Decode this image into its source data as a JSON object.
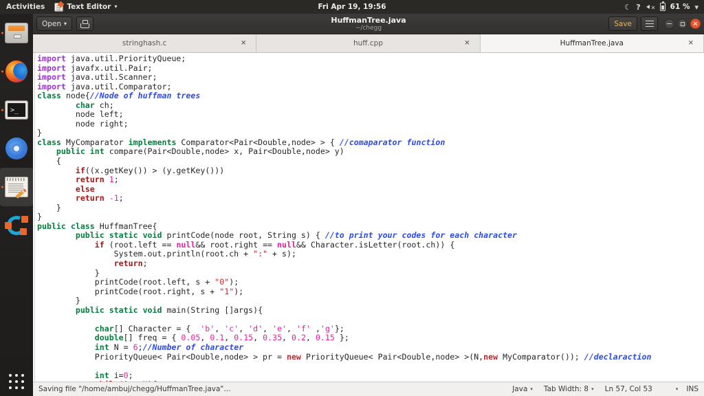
{
  "topbar": {
    "activities": "Activities",
    "app_menu": "Text Editor",
    "app_menu_caret": "▾",
    "clock": "Fri Apr 19, 19:56",
    "night_light_icon": "moon-icon",
    "help_icon": "?",
    "volume_icon": "volume-muted-icon",
    "battery_icon": "battery-icon",
    "battery_percent": "61 %",
    "system_menu_caret": "▾"
  },
  "dock": {
    "items": [
      {
        "name": "files",
        "icon": "file-manager-icon",
        "running": true,
        "active": false
      },
      {
        "name": "firefox",
        "icon": "firefox-icon",
        "running": true,
        "active": false
      },
      {
        "name": "terminal",
        "icon": "terminal-icon",
        "running": true,
        "active": false
      },
      {
        "name": "chromium",
        "icon": "chromium-icon",
        "running": false,
        "active": false
      },
      {
        "name": "text-editor",
        "icon": "text-editor-icon",
        "running": true,
        "active": true
      },
      {
        "name": "ubuntu-software",
        "icon": "ubuntu-software-icon",
        "running": false,
        "active": false
      }
    ],
    "show_apps": "show-applications-icon"
  },
  "window": {
    "open_button": "Open",
    "open_caret": "▾",
    "saveas_icon": "save-as-icon",
    "title": "HuffmanTree.java",
    "subtitle": "~/chegg",
    "save_button": "Save",
    "menu_icon": "hamburger-menu-icon",
    "minimize_icon": "minimize-icon",
    "maximize_icon": "maximize-icon",
    "close_icon": "close-icon"
  },
  "tabs": [
    {
      "label": "stringhash.c",
      "close": "✕",
      "active": false
    },
    {
      "label": "huff.cpp",
      "close": "✕",
      "active": false
    },
    {
      "label": "HuffmanTree.java",
      "close": "✕",
      "active": true
    }
  ],
  "editor": {
    "language": "Java",
    "lines": [
      [
        [
          "kp",
          "import"
        ],
        [
          "txt",
          " java.util.PriorityQueue;"
        ]
      ],
      [
        [
          "kp",
          "import"
        ],
        [
          "txt",
          " javafx.util.Pair;"
        ]
      ],
      [
        [
          "kp",
          "import"
        ],
        [
          "txt",
          " java.util.Scanner;"
        ]
      ],
      [
        [
          "kp",
          "import"
        ],
        [
          "txt",
          " java.util.Comparator;"
        ]
      ],
      [
        [
          "k",
          "class"
        ],
        [
          "txt",
          " node{"
        ],
        [
          "cmt",
          "//Node of huffman trees"
        ]
      ],
      [
        [
          "txt",
          "        "
        ],
        [
          "k",
          "char"
        ],
        [
          "txt",
          " ch;"
        ]
      ],
      [
        [
          "txt",
          "        node left;"
        ]
      ],
      [
        [
          "txt",
          "        node right;"
        ]
      ],
      [
        [
          "txt",
          "}"
        ]
      ],
      [
        [
          "k",
          "class"
        ],
        [
          "txt",
          " MyComparator "
        ],
        [
          "k",
          "implements"
        ],
        [
          "txt",
          " Comparator<Pair<Double,node> > { "
        ],
        [
          "cmt",
          "//comaparator function"
        ]
      ],
      [
        [
          "txt",
          "    "
        ],
        [
          "k",
          "public int"
        ],
        [
          "txt",
          " compare(Pair<Double,node> x, Pair<Double,node> y)"
        ]
      ],
      [
        [
          "txt",
          "    {"
        ]
      ],
      [
        [
          "txt",
          "        "
        ],
        [
          "ctl",
          "if"
        ],
        [
          "txt",
          "((x.getKey()) > (y.getKey()))"
        ]
      ],
      [
        [
          "txt",
          "        "
        ],
        [
          "ctl",
          "return"
        ],
        [
          "txt",
          " "
        ],
        [
          "num",
          "1"
        ],
        [
          "txt",
          ";"
        ]
      ],
      [
        [
          "txt",
          "        "
        ],
        [
          "ctl",
          "else"
        ]
      ],
      [
        [
          "txt",
          "        "
        ],
        [
          "ctl",
          "return"
        ],
        [
          "txt",
          " "
        ],
        [
          "num",
          "-1"
        ],
        [
          "txt",
          ";"
        ]
      ],
      [
        [
          "txt",
          "    }"
        ]
      ],
      [
        [
          "txt",
          "}"
        ]
      ],
      [
        [
          "k",
          "public class"
        ],
        [
          "txt",
          " HuffmanTree{"
        ]
      ],
      [
        [
          "txt",
          "        "
        ],
        [
          "k",
          "public static void"
        ],
        [
          "txt",
          " printCode(node root, String s) { "
        ],
        [
          "cmt",
          "//to print your codes for each character"
        ]
      ],
      [
        [
          "txt",
          "            "
        ],
        [
          "ctl",
          "if"
        ],
        [
          "txt",
          " (root.left == "
        ],
        [
          "nul",
          "null"
        ],
        [
          "txt",
          "&& root.right == "
        ],
        [
          "nul",
          "null"
        ],
        [
          "txt",
          "&& Character.isLetter(root.ch)) {"
        ]
      ],
      [
        [
          "txt",
          "                System.out.println(root.ch + "
        ],
        [
          "str",
          "\":\""
        ],
        [
          "txt",
          " + s);"
        ]
      ],
      [
        [
          "txt",
          "                "
        ],
        [
          "ctl",
          "return"
        ],
        [
          "txt",
          ";"
        ]
      ],
      [
        [
          "txt",
          "            }"
        ]
      ],
      [
        [
          "txt",
          "            printCode(root.left, s + "
        ],
        [
          "str",
          "\"0\""
        ],
        [
          "txt",
          ");"
        ]
      ],
      [
        [
          "txt",
          "            printCode(root.right, s + "
        ],
        [
          "str",
          "\"1\""
        ],
        [
          "txt",
          ");"
        ]
      ],
      [
        [
          "txt",
          "        }"
        ]
      ],
      [
        [
          "txt",
          "        "
        ],
        [
          "k",
          "public static void"
        ],
        [
          "txt",
          " main(String []args){"
        ]
      ],
      [
        [
          "txt",
          ""
        ]
      ],
      [
        [
          "txt",
          "            "
        ],
        [
          "k",
          "char"
        ],
        [
          "txt",
          "[] Character = {  "
        ],
        [
          "num",
          "'b'"
        ],
        [
          "txt",
          ", "
        ],
        [
          "num",
          "'c'"
        ],
        [
          "txt",
          ", "
        ],
        [
          "num",
          "'d'"
        ],
        [
          "txt",
          ", "
        ],
        [
          "num",
          "'e'"
        ],
        [
          "txt",
          ", "
        ],
        [
          "num",
          "'f'"
        ],
        [
          "txt",
          " ,"
        ],
        [
          "num",
          "'g'"
        ],
        [
          "txt",
          "};"
        ]
      ],
      [
        [
          "txt",
          "            "
        ],
        [
          "k",
          "double"
        ],
        [
          "txt",
          "[] freq = { "
        ],
        [
          "num",
          "0.05"
        ],
        [
          "txt",
          ", "
        ],
        [
          "num",
          "0.1"
        ],
        [
          "txt",
          ", "
        ],
        [
          "num",
          "0.15"
        ],
        [
          "txt",
          ", "
        ],
        [
          "num",
          "0.35"
        ],
        [
          "txt",
          ", "
        ],
        [
          "num",
          "0.2"
        ],
        [
          "txt",
          ", "
        ],
        [
          "num",
          "0.15"
        ],
        [
          "txt",
          " };"
        ]
      ],
      [
        [
          "txt",
          "            "
        ],
        [
          "k",
          "int"
        ],
        [
          "txt",
          " N = "
        ],
        [
          "num",
          "6"
        ],
        [
          "txt",
          ";"
        ],
        [
          "cmt",
          "//Number of character"
        ]
      ],
      [
        [
          "txt",
          "            PriorityQueue< Pair<Double,node> > pr = "
        ],
        [
          "nw",
          "new"
        ],
        [
          "txt",
          " PriorityQueue< Pair<Double,node> >(N,"
        ],
        [
          "nw",
          "new"
        ],
        [
          "txt",
          " MyComparator()); "
        ],
        [
          "cmt",
          "//declaraction"
        ]
      ],
      [
        [
          "txt",
          ""
        ]
      ],
      [
        [
          "txt",
          "            "
        ],
        [
          "k",
          "int"
        ],
        [
          "txt",
          " i="
        ],
        [
          "num",
          "0"
        ],
        [
          "txt",
          ";"
        ]
      ],
      [
        [
          "txt",
          "            "
        ],
        [
          "ctl",
          "while"
        ],
        [
          "txt",
          "(i < N){"
        ]
      ]
    ]
  },
  "statusbar": {
    "message": "Saving file \"/home/ambuj/chegg/HuffmanTree.java\"…",
    "language": "Java",
    "tab_width": "Tab Width: 8",
    "position": "Ln 57, Col 53",
    "insert_mode": "INS",
    "caret": "▾"
  }
}
